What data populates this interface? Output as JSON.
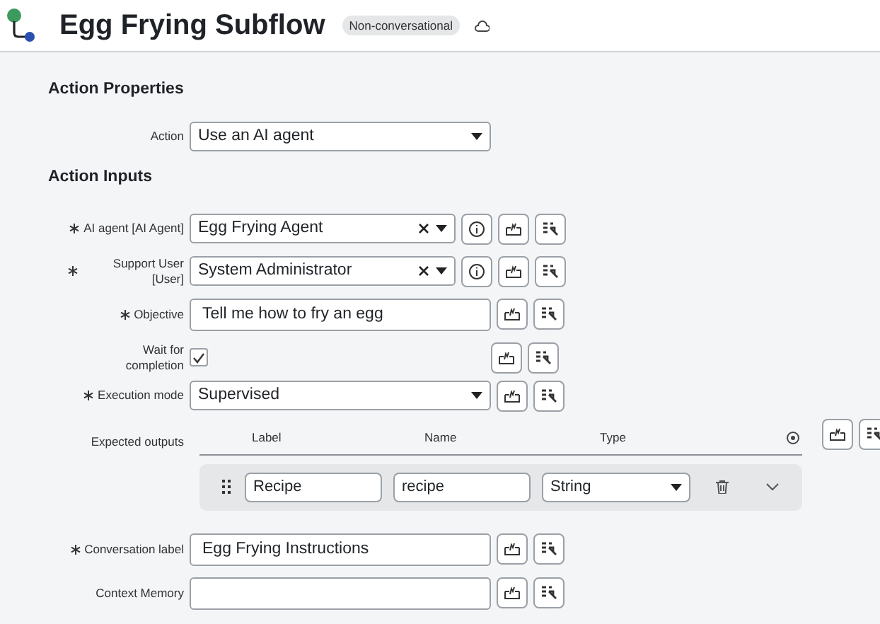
{
  "header": {
    "title": "Egg Frying Subflow",
    "badge": "Non-conversational"
  },
  "action_properties": {
    "heading": "Action Properties",
    "action": {
      "label": "Action",
      "value": "Use an AI agent"
    }
  },
  "action_inputs": {
    "heading": "Action Inputs",
    "fields": [
      {
        "kind": "reference",
        "label": "AI agent [AI Agent]",
        "required": true,
        "value": "Egg Frying Agent",
        "has_info": true
      },
      {
        "kind": "reference",
        "label": "Support User [User]",
        "required": true,
        "value": "System Administrator",
        "has_info": true
      },
      {
        "kind": "text",
        "label": "Objective",
        "required": true,
        "value": "Tell me how to fry an egg",
        "has_info": false
      },
      {
        "kind": "checkbox",
        "label": "Wait for completion",
        "required": false,
        "checked": true,
        "has_info": false
      },
      {
        "kind": "select",
        "label": "Execution mode",
        "required": true,
        "value": "Supervised",
        "has_info": false
      },
      {
        "kind": "table",
        "label": "Expected outputs",
        "required": false,
        "columns": [
          "Label",
          "Name",
          "Type"
        ],
        "rows": [
          {
            "label": "Recipe",
            "name": "recipe",
            "type": "String"
          }
        ]
      },
      {
        "kind": "text",
        "label": "Conversation label",
        "required": true,
        "value": "Egg Frying Instructions",
        "has_info": false
      },
      {
        "kind": "text",
        "label": "Context Memory",
        "required": false,
        "has_info": false
      }
    ]
  }
}
